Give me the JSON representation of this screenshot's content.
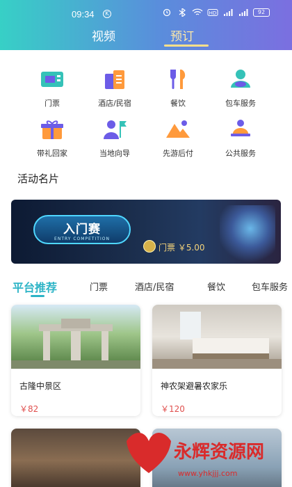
{
  "status": {
    "time": "09:34",
    "k_badge": "K",
    "battery": "92"
  },
  "top_tabs": {
    "video": "视频",
    "booking": "预订"
  },
  "categories": [
    {
      "label": "门票",
      "icon": "ticket-icon"
    },
    {
      "label": "酒店/民宿",
      "icon": "hotel-icon"
    },
    {
      "label": "餐饮",
      "icon": "dining-icon"
    },
    {
      "label": "包车服务",
      "icon": "charter-car-icon"
    },
    {
      "label": "带礼回家",
      "icon": "gift-icon"
    },
    {
      "label": "当地向导",
      "icon": "guide-icon"
    },
    {
      "label": "先游后付",
      "icon": "mountain-icon"
    },
    {
      "label": "公共服务",
      "icon": "public-service-icon"
    }
  ],
  "activity_section": {
    "title": "活动名片"
  },
  "banner": {
    "title": "入门赛",
    "subtitle": "ENTRY COMPETITION",
    "price_text": "门票 ￥5.00"
  },
  "rec_tabs": [
    "平台推荐",
    "门票",
    "酒店/民宿",
    "餐饮",
    "包车服务"
  ],
  "cards": [
    {
      "title": "古隆中景区",
      "price": "￥82"
    },
    {
      "title": "神农架避暑农家乐",
      "price": "￥120"
    },
    {
      "title": "",
      "price": ""
    },
    {
      "title": "",
      "price": ""
    }
  ],
  "watermark": {
    "text": "永辉资源网",
    "url": "www.yhkjjj.com"
  },
  "colors": {
    "accent": "#2cb4c6",
    "price": "#e0504e",
    "header_start": "#37d0c6",
    "header_end": "#7b6fe0"
  }
}
